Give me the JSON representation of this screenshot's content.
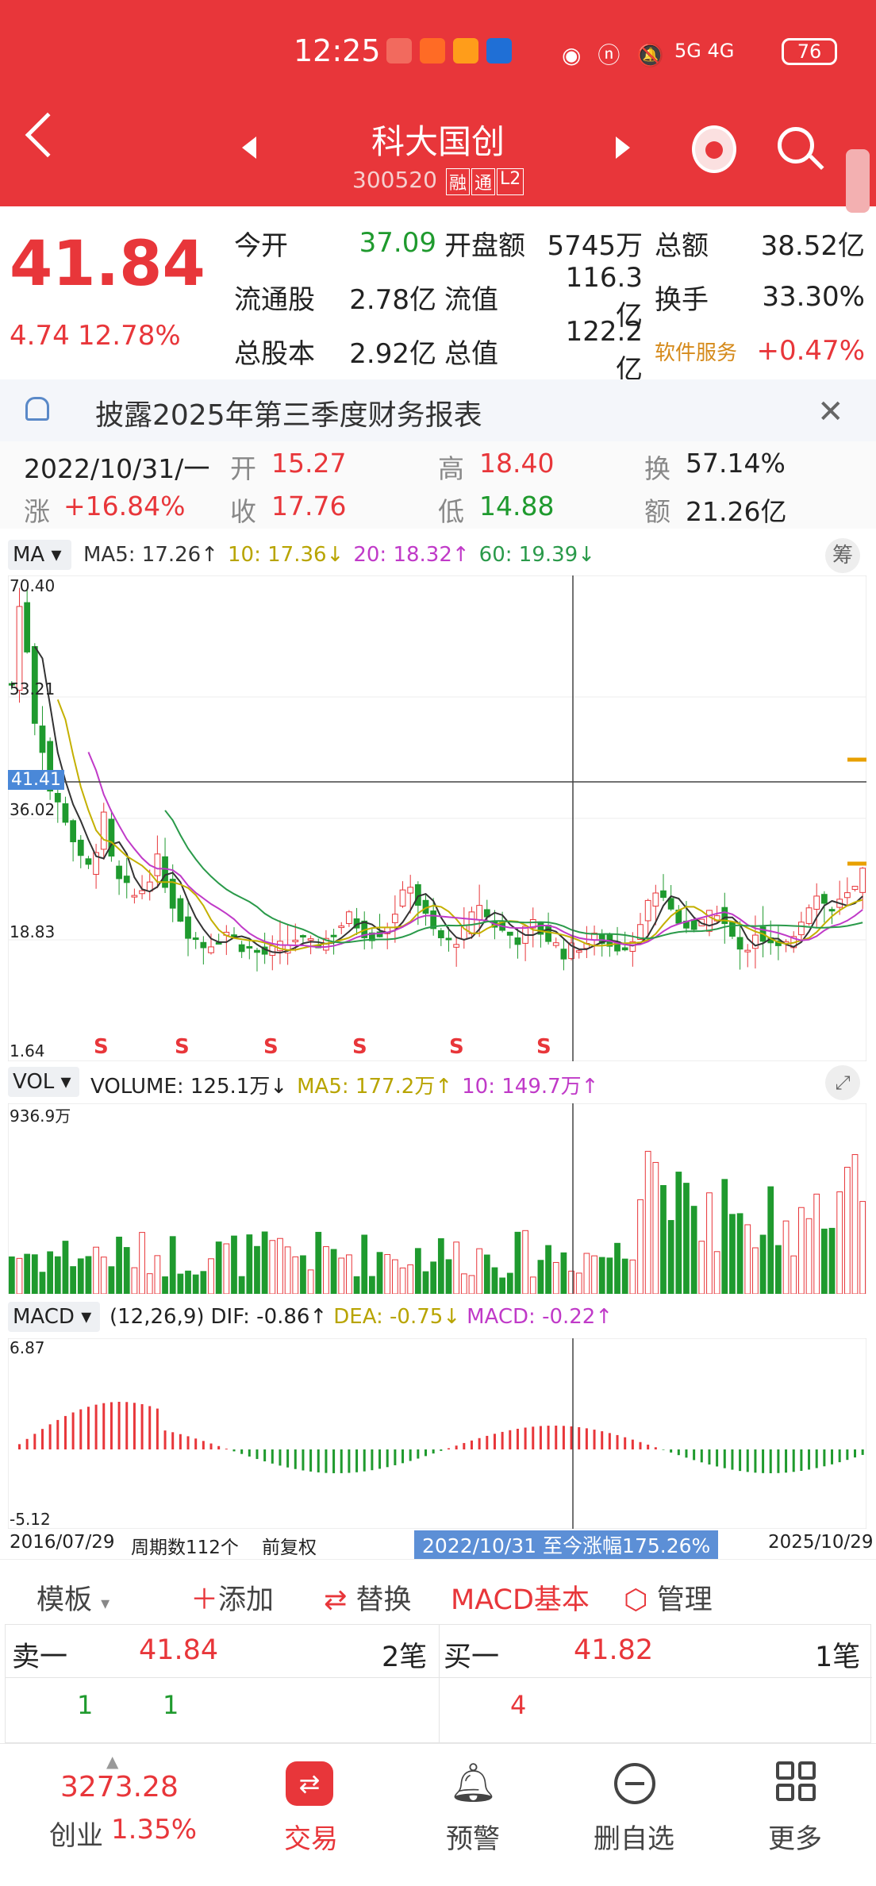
{
  "status_bar": {
    "time": "12:25",
    "network": "5G 4G",
    "battery": "76"
  },
  "header": {
    "title": "科大国创",
    "code": "300520",
    "tags": [
      "融",
      "通",
      "L2"
    ]
  },
  "quote": {
    "price": "41.84",
    "change": "4.74",
    "change_pct": "12.78%",
    "stats": [
      [
        {
          "k": "今开",
          "v": "37.09",
          "c": "grn"
        },
        {
          "k": "开盘额",
          "v": "5745万"
        },
        {
          "k": "总额",
          "v": "38.52亿"
        }
      ],
      [
        {
          "k": "流通股",
          "v": "2.78亿"
        },
        {
          "k": "流值",
          "v": "116.3亿"
        },
        {
          "k": "换手",
          "v": "33.30%"
        }
      ],
      [
        {
          "k": "总股本",
          "v": "2.92亿"
        },
        {
          "k": "总值",
          "v": "122.2亿"
        },
        {
          "k": "软件服务",
          "v": "+0.47%",
          "c": "red"
        }
      ]
    ]
  },
  "notice": {
    "text": "披露2025年第三季度财务报表"
  },
  "cursor_info": {
    "date": "2022/10/31/一",
    "open_label": "开",
    "open": "15.27",
    "high_label": "高",
    "high": "18.40",
    "turnover_label": "换",
    "turnover": "57.14%",
    "chg_label": "涨",
    "chg": "+16.84%",
    "close_label": "收",
    "close": "17.76",
    "low_label": "低",
    "low": "14.88",
    "amount_label": "额",
    "amount": "21.26亿"
  },
  "ma_panel": {
    "label": "MA",
    "ma5": "MA5: 17.26↑",
    "ma10": "10: 17.36↓",
    "ma20": "20: 18.32↑",
    "ma60": "60: 19.39↓",
    "chip": "筹",
    "y_top": "70.40",
    "y_2": "53.21",
    "y_cur": "41.41",
    "y_3": "36.02",
    "y_4": "18.83",
    "y_bot": "1.64",
    "s_marker": "S"
  },
  "vol_panel": {
    "label": "VOL",
    "volume": "VOLUME: 125.1万↓",
    "ma5": "MA5: 177.2万↑",
    "ma10": "10: 149.7万↑",
    "y_top": "936.9万"
  },
  "macd_panel": {
    "label": "MACD",
    "params": "(12,26,9)",
    "dif": "DIF: -0.86↑",
    "dea": "DEA: -0.75↓",
    "macd": "MACD: -0.22↑",
    "y_top": "6.87",
    "y_bot": "-5.12"
  },
  "footer_axis": {
    "start": "2016/07/29",
    "period": "周期数112个",
    "adj": "前复权",
    "range": "2022/10/31 至今涨幅175.26%",
    "end": "2025/10/29"
  },
  "toolbar": {
    "template": "模板",
    "add": "添加",
    "replace": "替换",
    "macd_basic": "MACD基本",
    "manage": "管理"
  },
  "orderbook": {
    "sell_label": "卖一",
    "sell_price": "41.84",
    "sell_count": "2笔",
    "buy_label": "买一",
    "buy_price": "41.82",
    "buy_count": "1笔",
    "sell_q1": "1",
    "sell_q2": "1",
    "buy_q1": "4"
  },
  "bottom_nav": {
    "index_value": "3273.28",
    "index_name": "创业",
    "index_pct": "1.35%",
    "trade": "交易",
    "alert": "预警",
    "remove": "删自选",
    "more": "更多"
  },
  "chart_data": {
    "type": "candlestick",
    "title": "",
    "xlabel": "",
    "ylabel": "",
    "ylim": [
      1.64,
      70.4
    ],
    "x": [
      "2016/07/29",
      "2022/10/31",
      "2025/10/29"
    ],
    "grid": true,
    "legend": "top-left"
  },
  "colors": {
    "up": "#e8363a",
    "down": "#1f9a2e",
    "ma5": "#333333",
    "ma10": "#c4b000",
    "ma20": "#c03ac8",
    "ma60": "#2a9a4a",
    "accent": "#e8363a"
  }
}
